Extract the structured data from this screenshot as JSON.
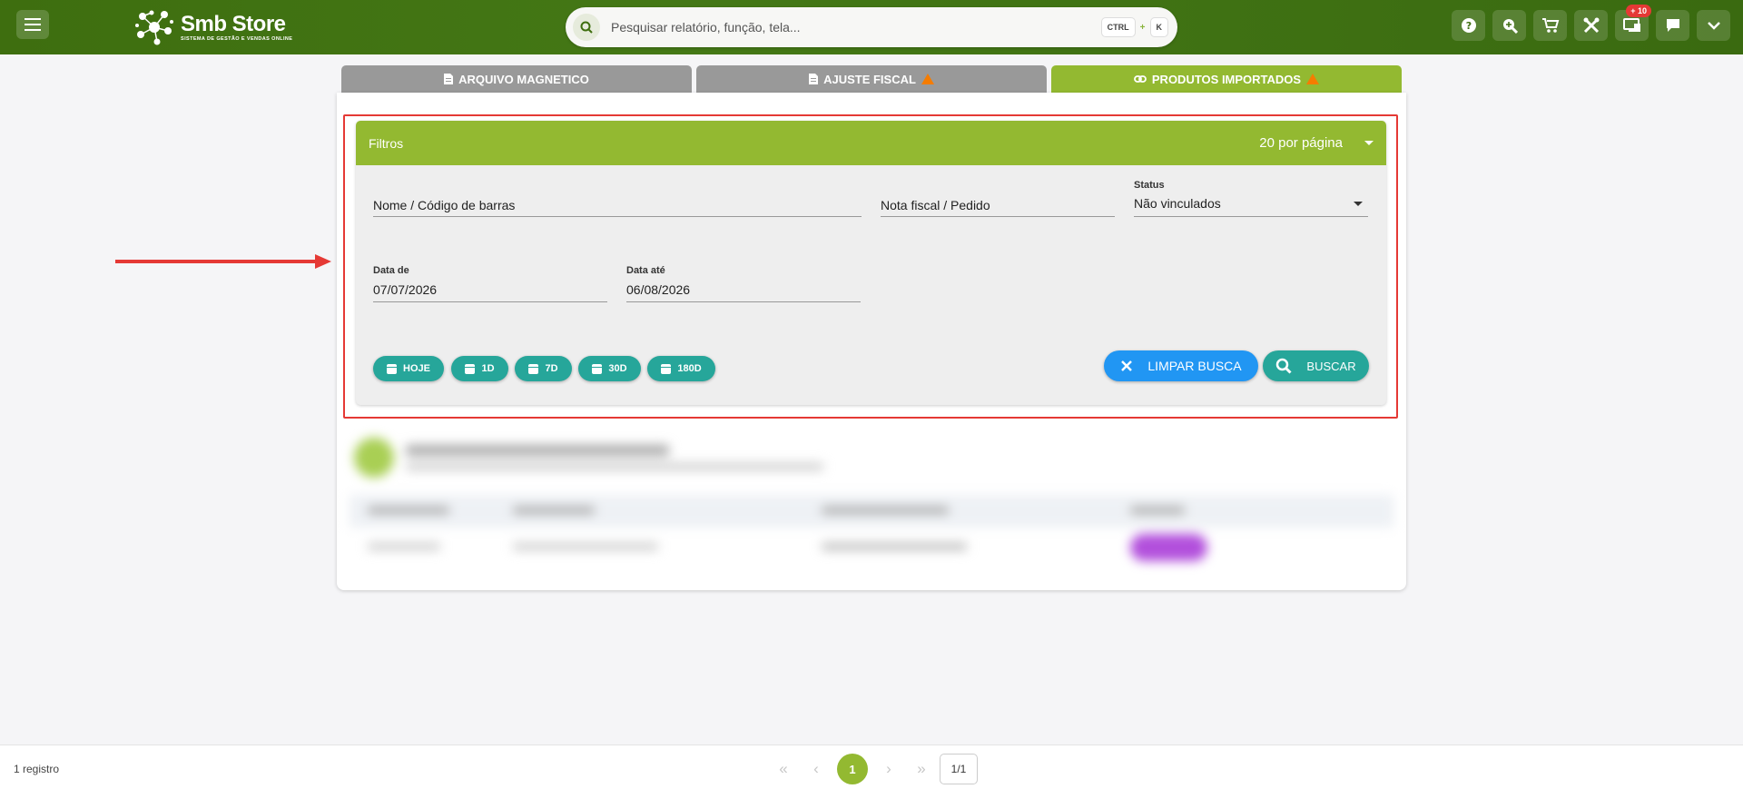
{
  "header": {
    "brand_title": "Smb Store",
    "brand_subtitle": "SISTEMA DE GESTÃO E VENDAS ONLINE",
    "search_placeholder": "Pesquisar relatório, função, tela...",
    "shortcut_ctrl": "CTRL",
    "shortcut_plus": "+",
    "shortcut_key": "K",
    "notification_badge": "+ 10",
    "icons": [
      "help-icon",
      "zoom-search-icon",
      "cart-icon",
      "tools-icon",
      "monitor-icon",
      "chat-icon",
      "chevron-down-icon"
    ]
  },
  "tabs": [
    {
      "label": "ARQUIVO MAGNETICO",
      "icon": "file-icon",
      "warning": false
    },
    {
      "label": "AJUSTE FISCAL",
      "icon": "file-icon",
      "warning": true
    },
    {
      "label": "PRODUTOS IMPORTADOS",
      "icon": "link-icon",
      "warning": true,
      "active": true
    }
  ],
  "filters": {
    "title": "Filtros",
    "per_page": "20 por página",
    "name_placeholder": "Nome / Código de barras",
    "invoice_placeholder": "Nota fiscal / Pedido",
    "status_label": "Status",
    "status_value": "Não vinculados",
    "date_from_label": "Data de",
    "date_from_value": "07/07/2026",
    "date_to_label": "Data até",
    "date_to_value": "06/08/2026",
    "quick_ranges": [
      "HOJE",
      "1D",
      "7D",
      "30D",
      "180D"
    ],
    "clear_button": "LIMPAR BUSCA",
    "search_button": "BUSCAR"
  },
  "footer": {
    "records": "1 registro",
    "current_page": "1",
    "page_total": "1/1"
  },
  "colors": {
    "header_green": "#3e6e0f",
    "accent_green": "#93b931",
    "teal": "#26a69a",
    "blue": "#2196f3",
    "highlight_red": "#e53935",
    "warning_orange": "#f57c00"
  }
}
